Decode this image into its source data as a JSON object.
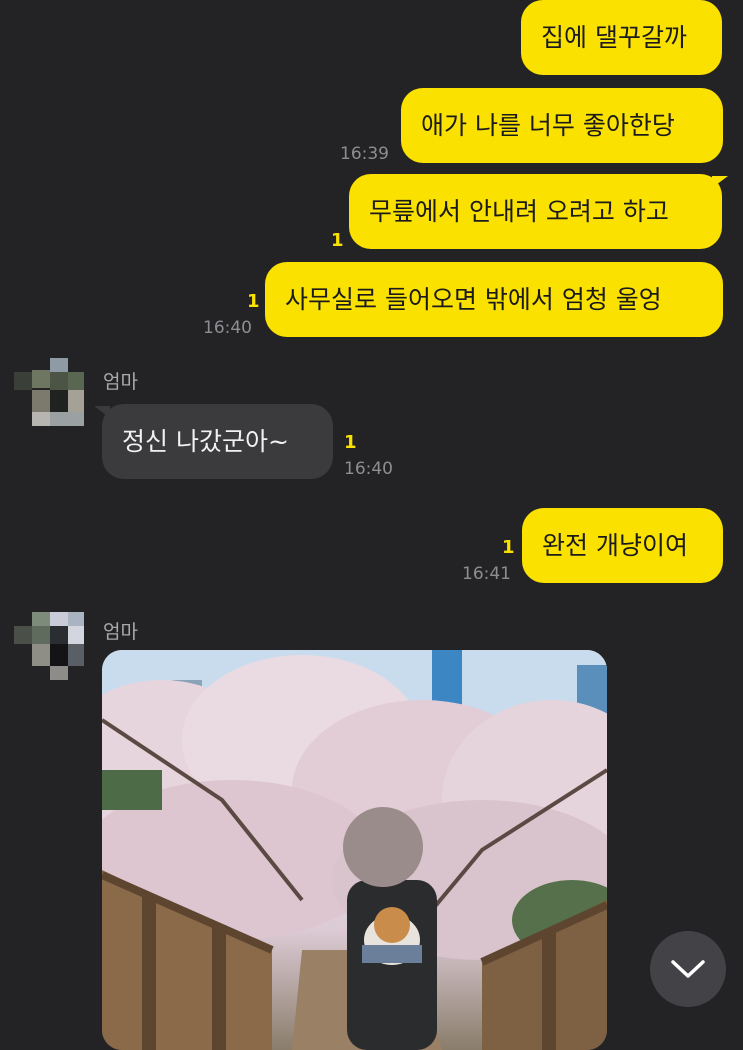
{
  "messages": {
    "m1": {
      "text": "집에 댈꾸갈까"
    },
    "m2": {
      "text": "애가 나를 너무 좋아한당",
      "time": "16:39"
    },
    "m3": {
      "text": "무릎에서 안내려 오려고 하고",
      "unread": "1"
    },
    "m4": {
      "text": "사무실로 들어오면 밖에서 엄청 울엉",
      "unread": "1",
      "time": "16:40"
    },
    "m5": {
      "sender": "엄마",
      "text": "정신  나갔군아~",
      "unread": "1",
      "time": "16:40"
    },
    "m6": {
      "text": "완전 개냥이여",
      "unread": "1",
      "time": "16:41"
    },
    "m7": {
      "sender": "엄마",
      "type": "photo"
    }
  },
  "colors": {
    "my_bubble": "#FAE100",
    "their_bubble": "#3b3b3d",
    "background": "#232325",
    "unread": "#FAE100"
  },
  "icons": {
    "scroll_down": "chevron-down-icon"
  }
}
